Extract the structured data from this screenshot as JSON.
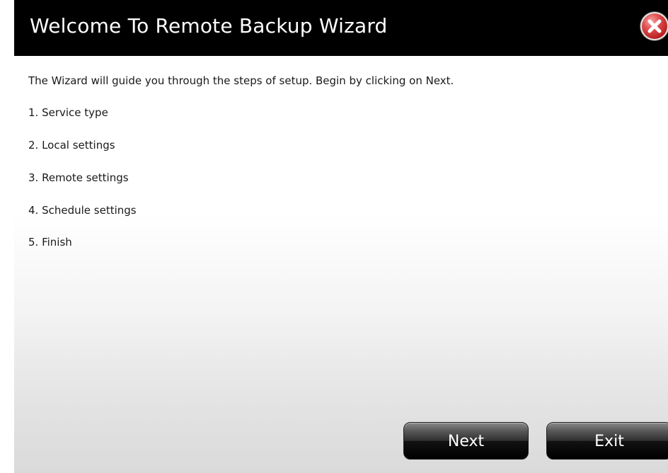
{
  "dialog": {
    "title": "Welcome To Remote Backup Wizard",
    "close_icon": "close-x-icon",
    "intro": "The Wizard will guide you through the steps of setup. Begin by clicking on Next.",
    "steps": [
      "1. Service type",
      "2. Local settings",
      "3. Remote settings",
      "4. Schedule settings",
      "5. Finish"
    ],
    "buttons": {
      "next_label": "Next",
      "exit_label": "Exit"
    }
  },
  "colors": {
    "titlebar_bg": "#000000",
    "title_text": "#ffffff",
    "close_red": "#b01818",
    "button_dark": "#1a1a1a"
  }
}
